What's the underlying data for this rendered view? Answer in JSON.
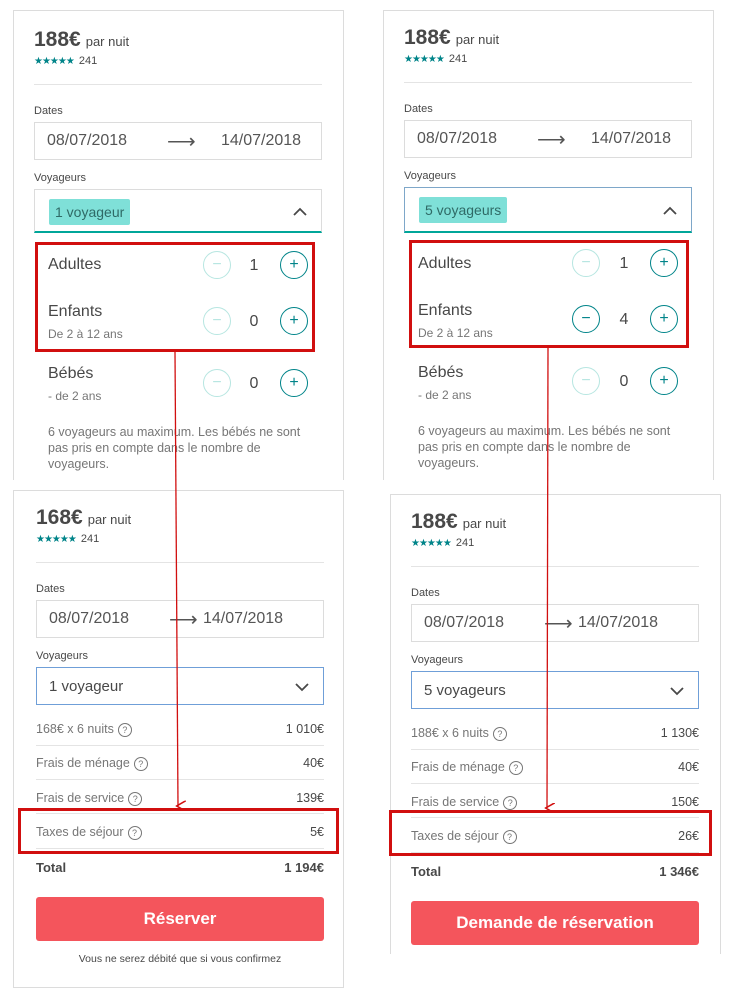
{
  "top_left": {
    "price": "188€",
    "per_night": "par nuit",
    "stars": "★★★★★",
    "reviews": "241",
    "dates_label": "Dates",
    "check_in": "08/07/2018",
    "check_out": "14/07/2018",
    "guests_label": "Voyageurs",
    "guests_value": "1 voyageur",
    "adults_label": "Adultes",
    "adults_count": "1",
    "children_label": "Enfants",
    "children_sub": "De 2 à 12 ans",
    "children_count": "0",
    "babies_label": "Bébés",
    "babies_sub": "- de 2 ans",
    "babies_count": "0",
    "note": "6 voyageurs au maximum. Les bébés ne sont pas pris en compte dans le nombre de voyageurs."
  },
  "top_right": {
    "price": "188€",
    "per_night": "par nuit",
    "stars": "★★★★★",
    "reviews": "241",
    "dates_label": "Dates",
    "check_in": "08/07/2018",
    "check_out": "14/07/2018",
    "guests_label": "Voyageurs",
    "guests_value": "5 voyageurs",
    "adults_label": "Adultes",
    "adults_count": "1",
    "children_label": "Enfants",
    "children_sub": "De 2 à 12 ans",
    "children_count": "4",
    "babies_label": "Bébés",
    "babies_sub": "- de 2 ans",
    "babies_count": "0",
    "note": "6 voyageurs au maximum. Les bébés ne sont pas pris en compte dans le nombre de voyageurs."
  },
  "bottom_left": {
    "price": "168€",
    "per_night": "par nuit",
    "stars": "★★★★★",
    "reviews": "241",
    "dates_label": "Dates",
    "check_in": "08/07/2018",
    "check_out": "14/07/2018",
    "guests_label": "Voyageurs",
    "guests_value": "1 voyageur",
    "nights_label": "168€ x 6 nuits",
    "nights_amount": "1 010€",
    "cleaning_label": "Frais de ménage",
    "cleaning_amount": "40€",
    "service_label": "Frais de service",
    "service_amount": "139€",
    "tax_label": "Taxes de séjour",
    "tax_amount": "5€",
    "total_label": "Total",
    "total_amount": "1 194€",
    "cta": "Réserver",
    "disclaimer": "Vous ne serez débité que si vous confirmez"
  },
  "bottom_right": {
    "price": "188€",
    "per_night": "par nuit",
    "stars": "★★★★★",
    "reviews": "241",
    "dates_label": "Dates",
    "check_in": "08/07/2018",
    "check_out": "14/07/2018",
    "guests_label": "Voyageurs",
    "guests_value": "5 voyageurs",
    "nights_label": "188€ x 6 nuits",
    "nights_amount": "1 130€",
    "cleaning_label": "Frais de ménage",
    "cleaning_amount": "40€",
    "service_label": "Frais de service",
    "service_amount": "150€",
    "tax_label": "Taxes de séjour",
    "tax_amount": "26€",
    "total_label": "Total",
    "total_amount": "1 346€",
    "cta": "Demande de réservation"
  },
  "colors": {
    "accent_teal": "#008489",
    "cta_red": "#f4555c",
    "highlight_red": "#d10f0f",
    "pill_teal": "#7fe0d8"
  },
  "icons": {
    "increment": "plus-icon",
    "decrement": "minus-icon",
    "chevron": "chevron-icon",
    "arrow": "arrow-right-icon",
    "help": "question-icon"
  }
}
